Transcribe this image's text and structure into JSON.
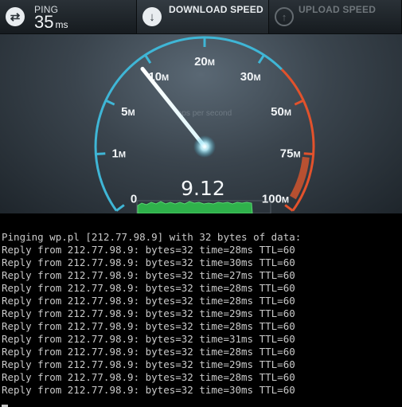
{
  "speedtest": {
    "ping": {
      "label": "PING",
      "value": "35",
      "unit": "ms",
      "icon": "swap-arrows-icon"
    },
    "download": {
      "label": "DOWNLOAD SPEED",
      "icon": "arrow-down-icon"
    },
    "upload": {
      "label": "UPLOAD SPEED",
      "icon": "arrow-up-icon"
    },
    "gauge": {
      "current_value": "9.12",
      "unit_caption": "bps per second",
      "needle_value_mbps": 9.12,
      "accent_color": "#3fb6d6",
      "alert_color": "#e2522c",
      "ticks": [
        {
          "num": "0",
          "unit": ""
        },
        {
          "num": "1",
          "unit": "M"
        },
        {
          "num": "5",
          "unit": "M"
        },
        {
          "num": "10",
          "unit": "M"
        },
        {
          "num": "20",
          "unit": "M"
        },
        {
          "num": "30",
          "unit": "M"
        },
        {
          "num": "50",
          "unit": "M"
        },
        {
          "num": "75",
          "unit": "M"
        },
        {
          "num": "100",
          "unit": "M"
        }
      ]
    }
  },
  "console": {
    "lines": [
      "Pinging wp.pl [212.77.98.9] with 32 bytes of data:",
      "Reply from 212.77.98.9: bytes=32 time=28ms TTL=60",
      "Reply from 212.77.98.9: bytes=32 time=30ms TTL=60",
      "Reply from 212.77.98.9: bytes=32 time=27ms TTL=60",
      "Reply from 212.77.98.9: bytes=32 time=28ms TTL=60",
      "Reply from 212.77.98.9: bytes=32 time=28ms TTL=60",
      "Reply from 212.77.98.9: bytes=32 time=29ms TTL=60",
      "Reply from 212.77.98.9: bytes=32 time=28ms TTL=60",
      "Reply from 212.77.98.9: bytes=32 time=31ms TTL=60",
      "Reply from 212.77.98.9: bytes=32 time=28ms TTL=60",
      "Reply from 212.77.98.9: bytes=32 time=29ms TTL=60",
      "Reply from 212.77.98.9: bytes=32 time=28ms TTL=60",
      "Reply from 212.77.98.9: bytes=32 time=30ms TTL=60"
    ]
  }
}
